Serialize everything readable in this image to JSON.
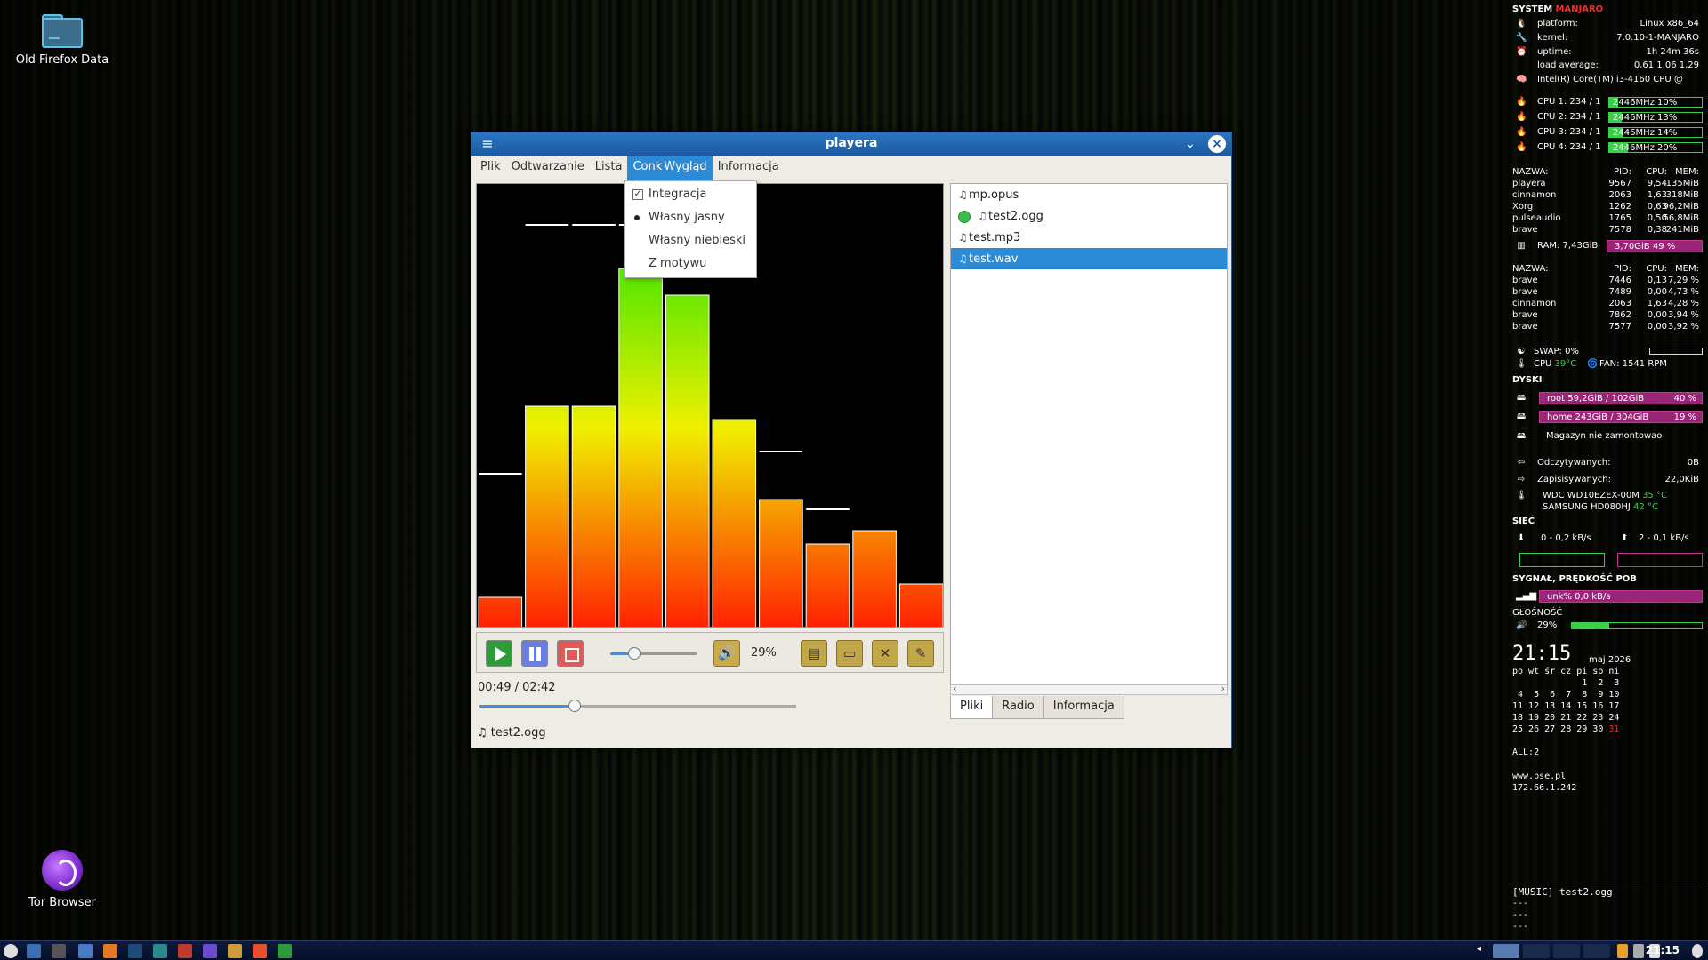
{
  "desktop": {
    "icons": [
      {
        "label": "Old Firefox Data"
      },
      {
        "label": "Tor Browser"
      }
    ]
  },
  "window": {
    "title": "playera",
    "menu": {
      "plik": "Plik",
      "odtwarzanie": "Odtwarzanie",
      "lista": "Lista",
      "conky": "Conk",
      "wyglad": "Wygląd",
      "informacja": "Informacja"
    },
    "dropdown": {
      "integracja": "Integracja",
      "wlasny_jasny": "Własny jasny",
      "wlasny_niebieski": "Własny niebieski",
      "z_motywu": "Z motywu"
    },
    "visualizer": {
      "bar_levels": [
        0.07,
        0.5,
        0.5,
        0.81,
        0.75,
        0.47,
        0.29,
        0.19,
        0.22,
        0.1
      ],
      "peak_levels": [
        0.35,
        0.91,
        0.91,
        0.91,
        0.75,
        0.4,
        0.4,
        0.27,
        0.22,
        0.1
      ],
      "colors": {
        "top": "#00e000",
        "mid": "#f0f000",
        "bottom": "#ff2000"
      }
    },
    "controls": {
      "slider_level": 0.28,
      "volume_pct": "29%",
      "time": "00:49 / 02:42",
      "seek_fraction": 0.3,
      "now_playing": "test2.ogg"
    },
    "playlist": {
      "items": [
        {
          "name": "mp.opus",
          "indent": false,
          "playing": false,
          "selected": false
        },
        {
          "name": "test2.ogg",
          "indent": true,
          "playing": true,
          "selected": false
        },
        {
          "name": "test.mp3",
          "indent": false,
          "playing": false,
          "selected": false
        },
        {
          "name": "test.wav",
          "indent": false,
          "playing": false,
          "selected": true
        }
      ],
      "tabs": [
        "Pliki",
        "Radio",
        "Informacja"
      ]
    }
  },
  "conky": {
    "system_label": "SYSTEM",
    "distro": "MANJARO",
    "platform_k": "platform:",
    "platform_v": "Linux x86_64",
    "kernel_k": "kernel:",
    "kernel_v": "7.0.10-1-MANJARO",
    "uptime_k": "uptime:",
    "uptime_v": "1h 24m 36s",
    "load_k": "load average:",
    "load_v": "0,61 1,06 1,29",
    "cpu_model": "Intel(R) Core(TM) i3-4160 CPU @",
    "cpus": [
      {
        "label": "CPU 1: 234 / 1",
        "bar": "2446MHz   10%",
        "fill": 0.1
      },
      {
        "label": "CPU 2: 234 / 1",
        "bar": "2446MHz   13%",
        "fill": 0.13
      },
      {
        "label": "CPU 3: 234 / 1",
        "bar": "2446MHz   14%",
        "fill": 0.14
      },
      {
        "label": "CPU 4: 234 / 1",
        "bar": "2446MHz   20%",
        "fill": 0.2
      }
    ],
    "proc_header": [
      "NAZWA:",
      "PID:",
      "CPU:",
      "MEM:"
    ],
    "proc_cpu": [
      [
        "playera",
        "9567",
        "9,54",
        "135MiB"
      ],
      [
        "cinnamon",
        "2063",
        "1,63",
        "318MiB"
      ],
      [
        "Xorg",
        "1262",
        "0,63",
        "96,2MiB"
      ],
      [
        "pulseaudio",
        "1765",
        "0,50",
        "56,8MiB"
      ],
      [
        "brave",
        "7578",
        "0,38",
        "241MiB"
      ]
    ],
    "ram_label": "RAM: 7,43GiB",
    "ram_bar": "3,70GiB  49 %",
    "proc_mem": [
      [
        "brave",
        "7446",
        "0,13",
        "7,29 %"
      ],
      [
        "brave",
        "7489",
        "0,00",
        "4,73 %"
      ],
      [
        "cinnamon",
        "2063",
        "1,63",
        "4,28 %"
      ],
      [
        "brave",
        "7862",
        "0,00",
        "3,94 %"
      ],
      [
        "brave",
        "7577",
        "0,00",
        "3,92 %"
      ]
    ],
    "swap": "SWAP: 0%",
    "cpu_temp_label": "CPU",
    "cpu_temp": "39°C",
    "fan": "FAN: 1541 RPM",
    "disks_label": "DYSKI",
    "root_bar": "root  59,2GiB / 102GiB",
    "root_pct": "40 %",
    "home_bar": "home  243GiB / 304GiB",
    "home_pct": "19 %",
    "magazyn": "Magazyn nie zamontowao",
    "read_k": "Odczytywanych:",
    "read_v": "0B",
    "write_k": "Zapisisywanych:",
    "write_v": "22,0KiB",
    "hdd1": "WDC WD10EZEX-00M",
    "hdd1_t": "35 °C",
    "hdd2": "SAMSUNG HD080HJ",
    "hdd2_t": "42 °C",
    "net_label": "SIEĆ",
    "down": "0 - 0,2 kB/s",
    "up": "2 - 0,1 kB/s",
    "signal_label": "SYGNAŁ, PRĘDKOŚĆ POB",
    "signal_bar": "unk%  0,0 kB/s",
    "vol_label": "GŁOŚNOŚĆ",
    "vol_pct": "29%",
    "vol_fill": 0.29,
    "clock": "21:15",
    "month": "maj 2026",
    "cal_head": "po wt śr cz pi so ni",
    "cal_rows": [
      "             1  2  3",
      " 4  5  6  7  8  9 10",
      "11 12 13 14 15 16 17",
      "18 19 20 21 22 23 24",
      "25 26 27 28 29 30 "
    ],
    "cal_today": "31",
    "all": "ALL:2",
    "site": "www.pse.pl",
    "ip": "172.66.1.242",
    "music": "[MUSIC] test2.ogg",
    "dash1": "---",
    "dash2": "---",
    "dash3": "---"
  },
  "taskbar": {
    "time": "21:15"
  }
}
